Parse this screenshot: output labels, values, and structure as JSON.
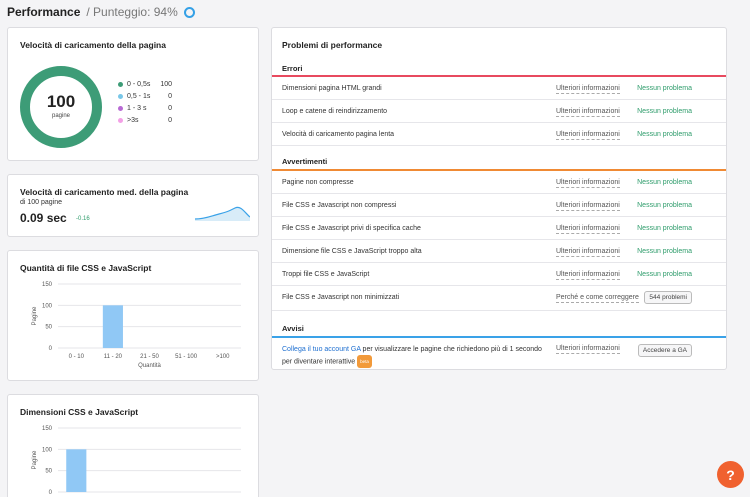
{
  "header": {
    "title": "Performance",
    "score": "/ Punteggio: 94%"
  },
  "speed_card": {
    "title": "Velocità di caricamento della pagina",
    "donut_value": "100",
    "donut_label": "pagine",
    "legend": [
      {
        "label": "0 - 0,5s",
        "value": "100",
        "color": "#3d9c77"
      },
      {
        "label": "0,5 - 1s",
        "value": "0",
        "color": "#79c7e8"
      },
      {
        "label": "1 - 3 s",
        "value": "0",
        "color": "#b86ad4"
      },
      {
        "label": ">3s",
        "value": "0",
        "color": "#f3a0e6"
      }
    ]
  },
  "avg_card": {
    "title": "Velocità di caricamento med. della pagina",
    "subtitle": "di 100 pagine",
    "value": "0.09 sec",
    "delta": "-0.16"
  },
  "css_count_card": {
    "title": "Quantità di file CSS e JavaScript",
    "chart_data": {
      "type": "bar",
      "categories": [
        "0 - 10",
        "11 - 20",
        "21 - 50",
        "51 - 100",
        ">100"
      ],
      "values": [
        0,
        100,
        0,
        0,
        0
      ],
      "ylim": [
        0,
        150
      ],
      "yticks": [
        0,
        50,
        100,
        150
      ],
      "xlabel": "Quantità",
      "ylabel": "Pagine",
      "bar_color": "#90c8f5",
      "grid": true
    }
  },
  "css_size_card": {
    "title": "Dimensioni CSS e JavaScript",
    "chart_data": {
      "type": "bar",
      "categories": [],
      "values": [
        100
      ],
      "ylim": [
        0,
        150
      ],
      "yticks": [
        0,
        50,
        100,
        150
      ],
      "xlabel": "",
      "ylabel": "Pagine",
      "bar_color": "#90c8f5",
      "grid": true
    }
  },
  "problems": {
    "title": "Problemi di performance",
    "sections": [
      {
        "name": "Errori",
        "color": "#e84a5f",
        "rows": [
          {
            "label": "Dimensioni pagina HTML grandi",
            "link": "Ulteriori informazioni",
            "status": "Nessun problema"
          },
          {
            "label": "Loop e catene di reindirizzamento",
            "link": "Ulteriori informazioni",
            "status": "Nessun problema"
          },
          {
            "label": "Velocità di caricamento pagina lenta",
            "link": "Ulteriori informazioni",
            "status": "Nessun problema"
          }
        ]
      },
      {
        "name": "Avvertimenti",
        "color": "#f08a34",
        "rows": [
          {
            "label": "Pagine non compresse",
            "link": "Ulteriori informazioni",
            "status": "Nessun problema"
          },
          {
            "label": "File CSS e Javascript non compressi",
            "link": "Ulteriori informazioni",
            "status": "Nessun problema"
          },
          {
            "label": "File CSS e Javascript privi di specifica cache",
            "link": "Ulteriori informazioni",
            "status": "Nessun problema"
          },
          {
            "label": "Dimensione file CSS e JavaScript troppo alta",
            "link": "Ulteriori informazioni",
            "status": "Nessun problema"
          },
          {
            "label": "Troppi file CSS e JavaScript",
            "link": "Ulteriori informazioni",
            "status": "Nessun problema"
          },
          {
            "label": "File CSS e Javascript non minimizzati",
            "link": "Perché e come correggere",
            "button": "544 problemi"
          }
        ]
      },
      {
        "name": "Avvisi",
        "color": "#3aa2e8",
        "ga_link": "Collega il tuo account GA",
        "ga_text": " per visualizzare le pagine che richiedono più di 1 secondo per diventare interattive",
        "beta": "beta",
        "link": "Ulteriori informazioni",
        "button": "Accedere a GA"
      }
    ]
  },
  "help_button": "?"
}
